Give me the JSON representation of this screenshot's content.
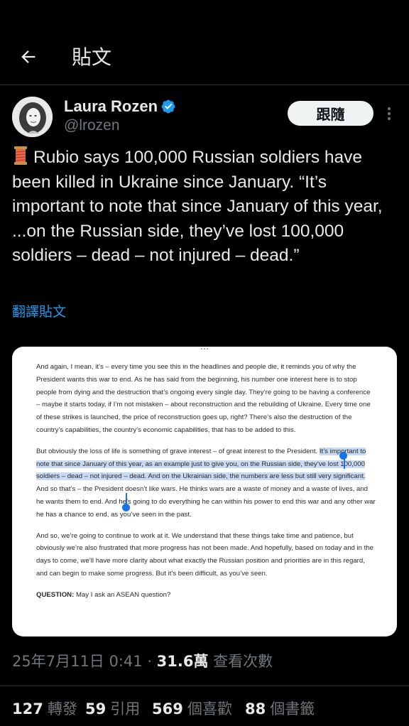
{
  "header": {
    "title": "貼文",
    "back_icon": "arrow-left-icon"
  },
  "author": {
    "name": "Laura Rozen",
    "handle": "@lrozen",
    "verified_color": "#1d9bf0"
  },
  "follow_label": "跟隨",
  "tweet": {
    "text": "Rubio says 100,000 Russian soldiers have been killed in Ukraine since January. “It’s important to note that since January of this year, ...on the Russian side, they’ve lost 100,000 soldiers – dead – not injured – dead.”",
    "thread_icon": "thread-spool-emoji",
    "translate_label": "翻譯貼文"
  },
  "media": {
    "p1": "And again, I mean, it’s – every time you see this in the headlines and people die, it reminds you of why the President wants this war to end.  As he has said from the beginning, his number one interest here is to stop people from dying and the destruction that’s ongoing every single day.  They’re going to be having a conference – maybe it starts today, if I’m not mistaken – about reconstruction and the rebuilding of Ukraine.  Every time one of these strikes is launched, the price of reconstruction goes up, right?  There’s also the destruction of the country’s capabilities, the country’s economic capabilities, that has to be added to this.",
    "p2_before": "But obviously the loss of life is something of grave interest – of great interest to the President.  ",
    "p2_highlight": "It’s important to note that since January of this year, as an example just to give you, on the Russian side, they’ve lost 100,000 soldiers – dead – not injured – dead.  And on the Ukrainian side, the numbers are less but still very significant.",
    "p2_after": "  And so that’s – the President doesn’t like wars.  He thinks wars are a waste of money and a waste of lives, and he wants them to end.  And he’s going to do everything he can within his power to end this war and any other war he has a chance to end, as you’ve seen in the past.",
    "p3": "And so, we’re going to continue to work at it.  We understand that these things take time and patience, but obviously we’re also frustrated that more progress has not been made.  And hopefully, based on today and in the days to come, we’ll have more clarity about what exactly the Russian position and priorities are in this regard, and can begin to make some progress.  But it’s been difficult, as you’ve seen.",
    "q_label": "QUESTION:",
    "q_text": "  May I ask an ASEAN question?",
    "selection_color": "#1a73e8"
  },
  "meta": {
    "timestamp": "25年7月11日 0:41",
    "sep": " · ",
    "views": "31.6萬",
    "views_label": " 查看次數"
  },
  "stats": {
    "reposts": {
      "count": "127",
      "label": "轉發"
    },
    "quotes": {
      "count": "59",
      "label": "引用"
    },
    "likes": {
      "count": "569",
      "label": "個喜歡"
    },
    "bookmarks": {
      "count": "88",
      "label": "個書籤"
    }
  }
}
